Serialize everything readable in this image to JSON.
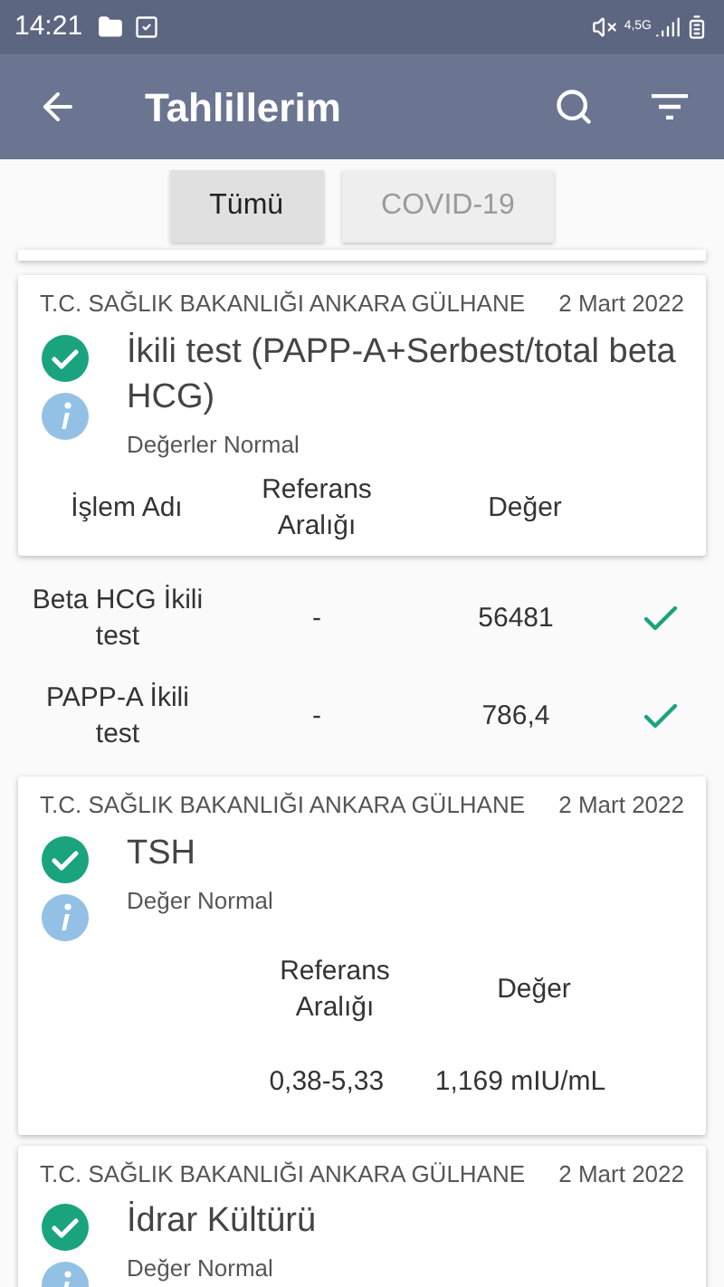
{
  "status_bar": {
    "time": "14:21",
    "network": "4,5G"
  },
  "app_bar": {
    "title": "Tahlillerim"
  },
  "filter_tabs": [
    {
      "label": "Tümü",
      "selected": true
    },
    {
      "label": "COVID-19",
      "selected": false
    }
  ],
  "results": [
    {
      "lab": "T.C. SAĞLIK BAKANLIĞI ANKARA GÜLHANE",
      "date": "2 Mart 2022",
      "test": "İkili test (PAPP-A+Serbest/total beta HCG)",
      "status": "Değerler Normal",
      "columns": [
        "İşlem Adı",
        "Referans Aralığı",
        "Değer"
      ],
      "rows": [
        {
          "name": "Beta HCG İkili test",
          "reference": "-",
          "value": "56481",
          "normal": true
        },
        {
          "name": "PAPP-A İkili test",
          "reference": "-",
          "value": "786,4",
          "normal": true
        }
      ]
    },
    {
      "lab": "T.C. SAĞLIK BAKANLIĞI ANKARA GÜLHANE",
      "date": "2 Mart 2022",
      "test": "TSH",
      "status": "Değer Normal",
      "columns": [
        "Referans Aralığı",
        "Değer"
      ],
      "rows": [
        {
          "reference": "0,38-5,33",
          "value": "1,169 mIU/mL",
          "normal": false
        }
      ]
    },
    {
      "lab": "T.C. SAĞLIK BAKANLIĞI ANKARA GÜLHANE",
      "date": "2 Mart 2022",
      "test": "İdrar Kültürü",
      "status": "Değer Normal"
    }
  ]
}
